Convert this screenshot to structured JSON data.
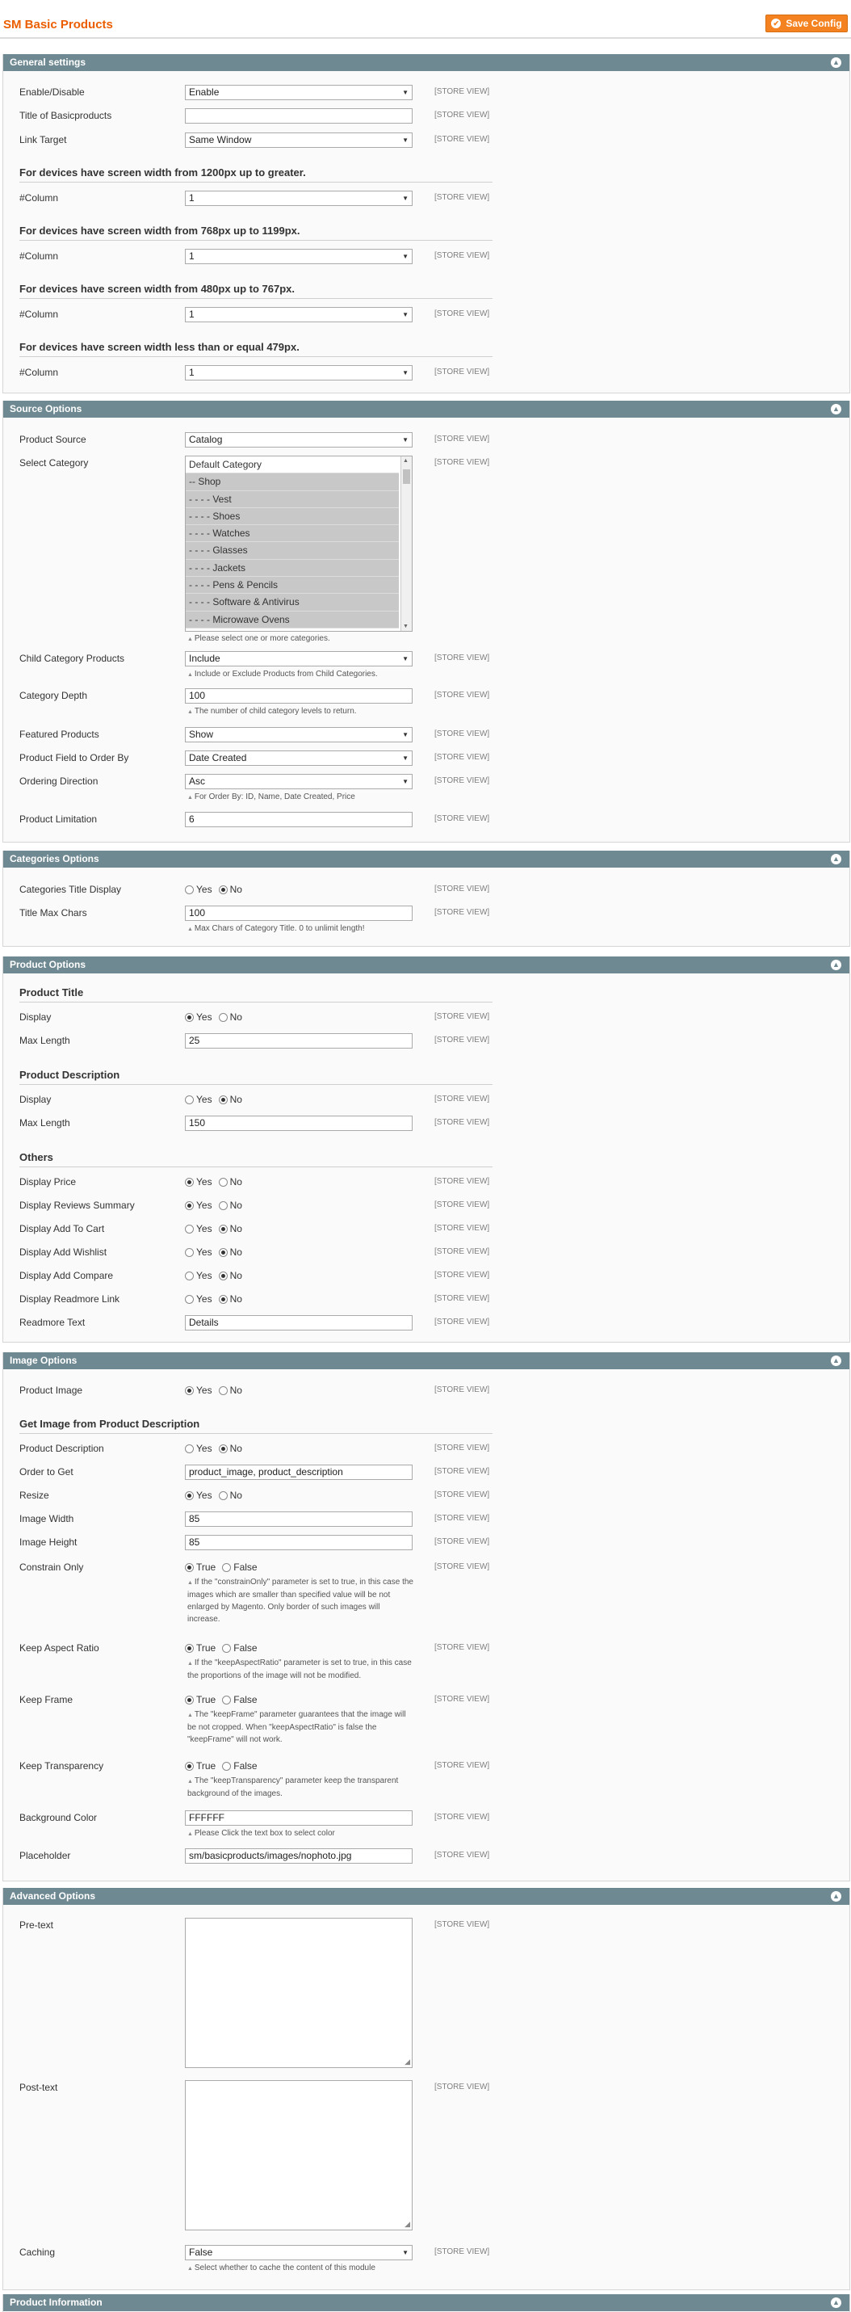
{
  "page": {
    "title": "SM Basic Products",
    "save_label": "Save Config"
  },
  "store_view": "[STORE VIEW]",
  "general": {
    "header": "General settings",
    "enable_label": "Enable/Disable",
    "enable_value": "Enable",
    "title_label": "Title of Basicproducts",
    "title_value": "",
    "link_label": "Link Target",
    "link_value": "Same Window",
    "dev1": "For devices have screen width from 1200px up to greater.",
    "dev2": "For devices have screen width from 768px up to 1199px.",
    "dev3": "For devices have screen width from 480px up to 767px.",
    "dev4": "For devices have screen width less than or equal 479px.",
    "col_label": "#Column",
    "col_value": "1"
  },
  "source": {
    "header": "Source Options",
    "product_source_label": "Product Source",
    "product_source_value": "Catalog",
    "select_category_label": "Select Category",
    "categories": [
      "Default Category",
      "-- Shop",
      "- - - - Vest",
      "- - - - Shoes",
      "- - - - Watches",
      "- - - - Glasses",
      "- - - - Jackets",
      "- - - - Pens & Pencils",
      "- - - - Software & Antivirus",
      "- - - - Microwave Ovens"
    ],
    "category_note": "Please select one or more categories.",
    "child_label": "Child Category Products",
    "child_value": "Include",
    "child_note": "Include or Exclude Products from Child Categories.",
    "depth_label": "Category Depth",
    "depth_value": "100",
    "depth_note": "The number of child category levels to return.",
    "featured_label": "Featured Products",
    "featured_value": "Show",
    "order_field_label": "Product Field to Order By",
    "order_field_value": "Date Created",
    "order_dir_label": "Ordering Direction",
    "order_dir_value": "Asc",
    "order_note": "For Order By: ID, Name, Date Created, Price",
    "limit_label": "Product Limitation",
    "limit_value": "6"
  },
  "categories_opts": {
    "header": "Categories Options",
    "title_display_label": "Categories Title Display",
    "max_chars_label": "Title Max Chars",
    "max_chars_value": "100",
    "max_chars_note": "Max Chars of Category Title. 0 to unlimit length!"
  },
  "radio": {
    "yes": "Yes",
    "no": "No",
    "true": "True",
    "false": "False"
  },
  "product": {
    "header": "Product Options",
    "title_head": "Product Title",
    "display_label": "Display",
    "max_len_label": "Max Length",
    "title_max_value": "25",
    "desc_head": "Product Description",
    "desc_max_value": "150",
    "others_head": "Others",
    "price_label": "Display Price",
    "reviews_label": "Display Reviews Summary",
    "cart_label": "Display Add To Cart",
    "wishlist_label": "Display Add Wishlist",
    "compare_label": "Display Add Compare",
    "readmore_label": "Display Readmore Link",
    "readmore_text_label": "Readmore Text",
    "readmore_text_value": "Details"
  },
  "image": {
    "header": "Image Options",
    "product_image_label": "Product Image",
    "get_head": "Get Image from Product Description",
    "desc_label": "Product Description",
    "order_label": "Order to Get",
    "order_value": "product_image, product_description",
    "resize_label": "Resize",
    "width_label": "Image Width",
    "width_value": "85",
    "height_label": "Image Height",
    "height_value": "85",
    "constrain_label": "Constrain Only",
    "constrain_note": "If the \"constrainOnly\" parameter is set to true, in this case the images which are smaller than specified value will be not enlarged by Magento. Only border of such images will increase.",
    "aspect_label": "Keep Aspect Ratio",
    "aspect_note": "If the \"keepAspectRatio\" parameter is set to true, in this case the proportions of the image will not be modified.",
    "frame_label": "Keep Frame",
    "frame_note": "The \"keepFrame\" parameter guarantees that the image will be not cropped. When \"keepAspectRatio\" is false the \"keepFrame\" will not work.",
    "transparency_label": "Keep Transparency",
    "transparency_note": "The \"keepTransparency\" parameter keep the transparent background of the images.",
    "bg_label": "Background Color",
    "bg_value": "FFFFFF",
    "bg_note": "Please Click the text box to select color",
    "placeholder_label": "Placeholder",
    "placeholder_value": "sm/basicproducts/images/nophoto.jpg"
  },
  "advanced": {
    "header": "Advanced Options",
    "pre_label": "Pre-text",
    "post_label": "Post-text",
    "caching_label": "Caching",
    "caching_value": "False",
    "caching_note": "Select whether to cache the content of this module"
  },
  "info": {
    "header": "Product Information"
  }
}
